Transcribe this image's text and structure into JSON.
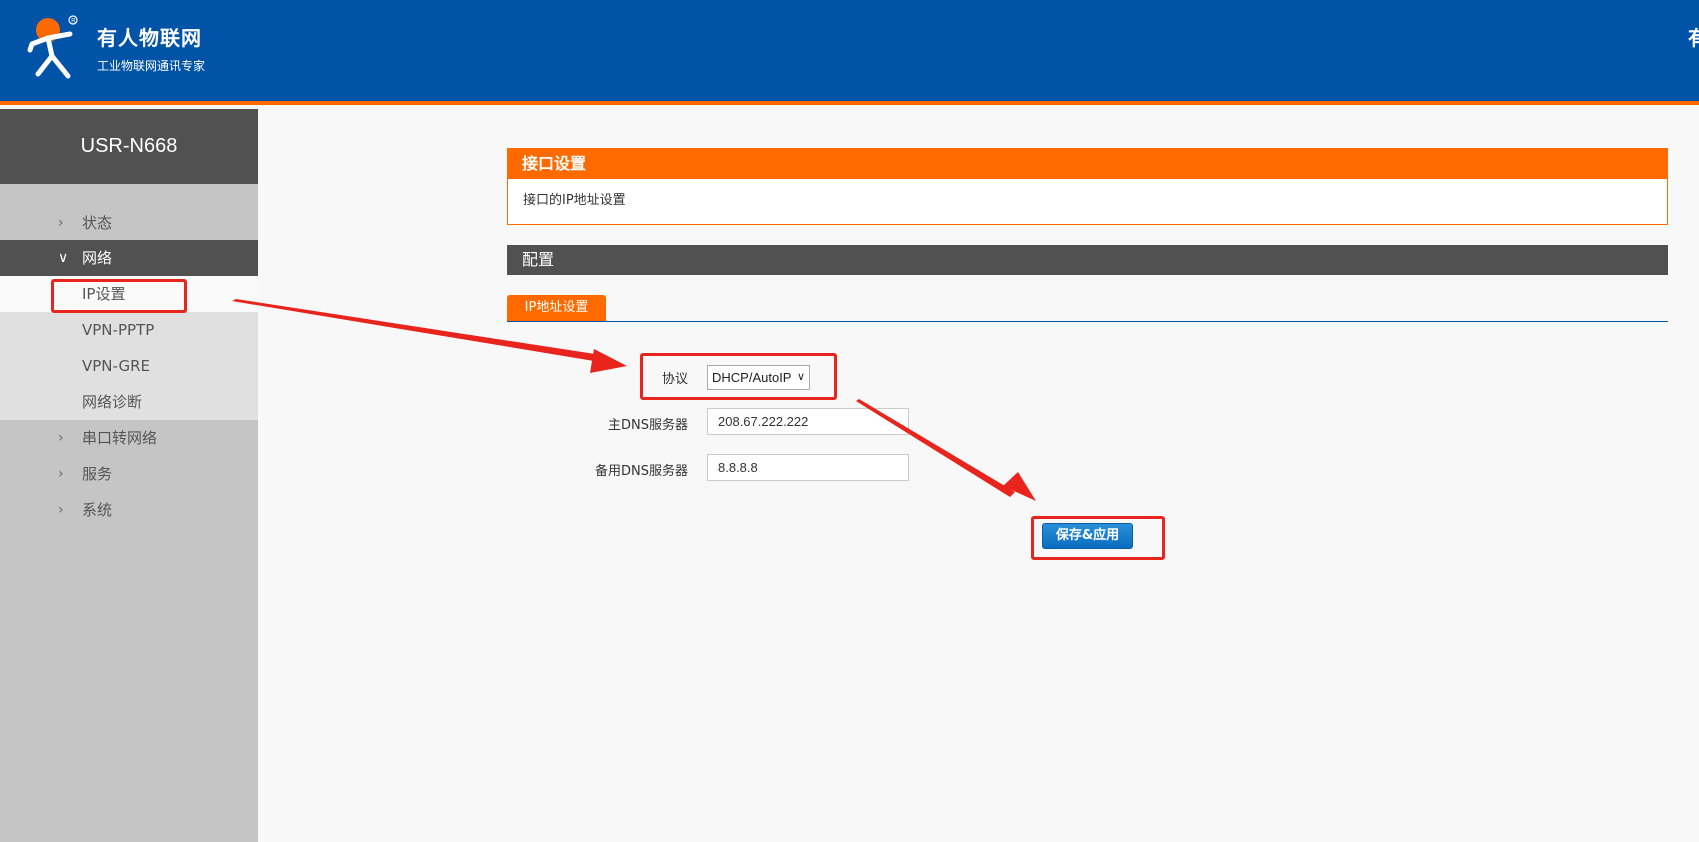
{
  "header": {
    "brand_name": "有人物联网",
    "brand_slogan": "工业物联网通讯专家",
    "right_text": "有",
    "logo_icon": "usr-logo-icon"
  },
  "sidebar": {
    "device_name": "USR-N668",
    "items": [
      {
        "label": "状态",
        "icon": "chevron-right-icon"
      },
      {
        "label": "网络",
        "icon": "chevron-down-icon"
      },
      {
        "label": "串口转网络",
        "icon": "chevron-right-icon"
      },
      {
        "label": "服务",
        "icon": "chevron-right-icon"
      },
      {
        "label": "系统",
        "icon": "chevron-right-icon"
      }
    ],
    "sub_items": [
      {
        "label": "IP设置"
      },
      {
        "label": "VPN-PPTP"
      },
      {
        "label": "VPN-GRE"
      },
      {
        "label": "网络诊断"
      }
    ]
  },
  "main": {
    "section_title": "接口设置",
    "section_desc": "接口的IP地址设置",
    "config_title": "配置",
    "tab_label": "IP地址设置",
    "protocol_label": "协议",
    "protocol_value": "DHCP/AutoIP",
    "dns_primary_label": "主DNS服务器",
    "dns_primary_value": "208.67.222.222",
    "dns_backup_label": "备用DNS服务器",
    "dns_backup_value": "8.8.8.8",
    "save_label": "保存&应用"
  },
  "colors": {
    "header_bg": "#0053a6",
    "accent": "#ff6a00",
    "sidebar_dark": "#515151",
    "annotation": "#e8241c"
  }
}
